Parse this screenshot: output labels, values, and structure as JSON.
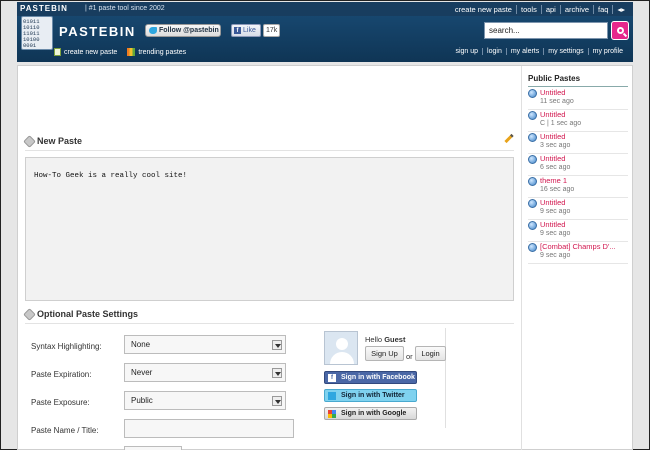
{
  "topbar": {
    "brand": "PASTEBIN",
    "tagline": "| #1 paste tool since 2002",
    "nav": [
      "create new paste",
      "tools",
      "api",
      "archive",
      "faq"
    ]
  },
  "header": {
    "logo_binary": [
      "01011",
      "10110",
      "11011",
      "10100",
      "0001"
    ],
    "site_name": "PASTEBIN",
    "follow_label": "Follow @pastebin",
    "like_label": "Like",
    "like_count": "17k",
    "search_value": "search...",
    "subnav_left": [
      "create new paste",
      "trending pastes"
    ],
    "subnav_right": [
      "sign up",
      "login",
      "my alerts",
      "my settings",
      "my profile"
    ]
  },
  "main": {
    "new_paste_title": "New Paste",
    "paste_text": "How-To Geek is a really cool site!",
    "optional_title": "Optional Paste Settings",
    "settings": [
      {
        "label": "Syntax Highlighting:",
        "value": "None"
      },
      {
        "label": "Paste Expiration:",
        "value": "Never"
      },
      {
        "label": "Paste Exposure:",
        "value": "Public"
      }
    ],
    "name_label": "Paste Name / Title:"
  },
  "login": {
    "hello": "Hello",
    "user": "Guest",
    "signup": "Sign Up",
    "or": "or",
    "login": "Login",
    "facebook": "Sign in with Facebook",
    "twitter": "Sign in with Twitter",
    "google": "Sign in with Google"
  },
  "sidebar": {
    "title": "Public Pastes",
    "items": [
      {
        "title": "Untitled",
        "meta": "11 sec ago"
      },
      {
        "title": "Untitled",
        "meta": "C | 1 sec ago"
      },
      {
        "title": "Untitled",
        "meta": "3 sec ago"
      },
      {
        "title": "Untitled",
        "meta": "6 sec ago"
      },
      {
        "title": "theme 1",
        "meta": "16 sec ago"
      },
      {
        "title": "Untitled",
        "meta": "9 sec ago"
      },
      {
        "title": "Untitled",
        "meta": "9 sec ago"
      },
      {
        "title": "[Combat] Champs D'...",
        "meta": "9 sec ago"
      }
    ]
  },
  "colors": {
    "header_bg": "#17476f",
    "accent_pink": "#e6268c",
    "paste_link": "#d2174f"
  }
}
